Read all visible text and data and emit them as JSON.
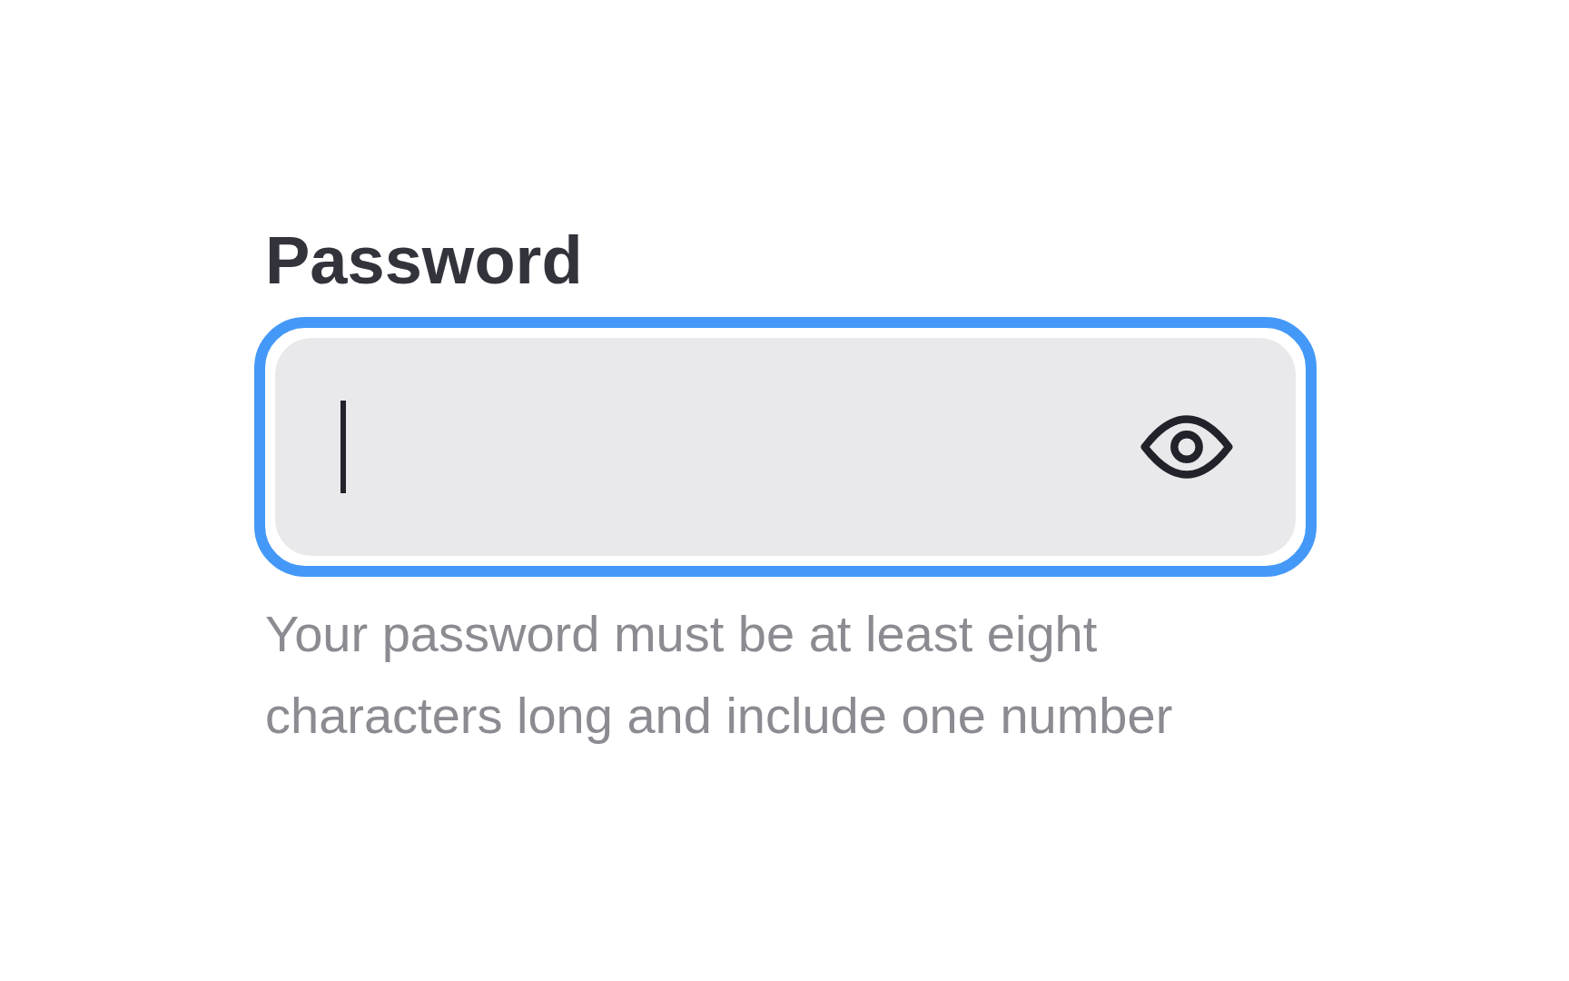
{
  "label": "Password",
  "field": {
    "focused": true
  },
  "helper_text": "Your password must be at least eight characters long and include one number"
}
